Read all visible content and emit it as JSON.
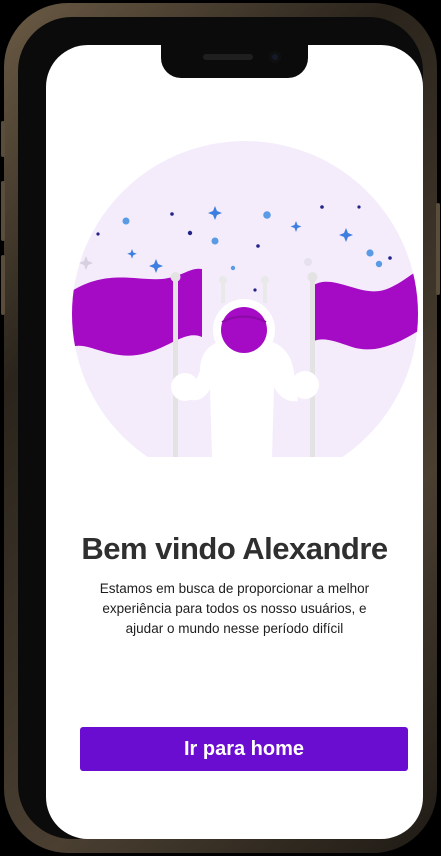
{
  "welcome": {
    "title": "Bem vindo Alexandre",
    "subtitle": "Estamos em busca de proporcionar a melhor experiência para todos os nosso usuários, e ajudar o mundo nesse período difícil"
  },
  "actions": {
    "primary_label": "Ir para home"
  },
  "colors": {
    "primary": "#6A0DD0",
    "flag": "#A50BC4",
    "circle_bg": "#F4ECFB",
    "star_blue": "#3D7FE0",
    "title_text": "#2F2F2F"
  },
  "illustration": {
    "name": "astronaut-with-flags"
  }
}
